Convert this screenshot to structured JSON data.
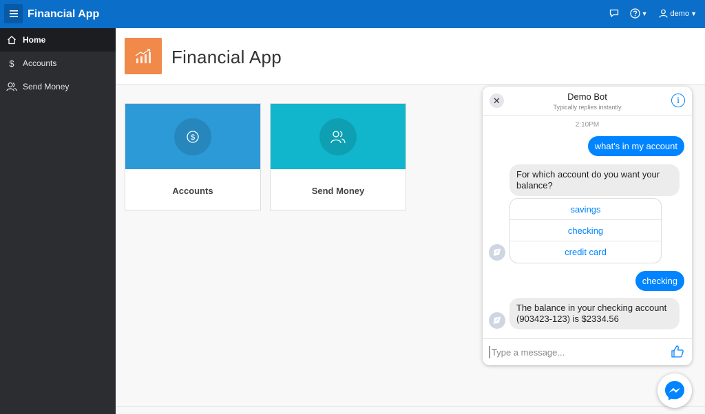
{
  "topbar": {
    "app_title": "Financial App",
    "user_label": "demo",
    "icons": [
      "menu-icon",
      "chat-icon",
      "help-icon",
      "user-icon"
    ]
  },
  "sidebar": {
    "items": [
      {
        "label": "Home",
        "icon": "home-icon",
        "active": true
      },
      {
        "label": "Accounts",
        "icon": "dollar-icon",
        "active": false
      },
      {
        "label": "Send Money",
        "icon": "users-icon",
        "active": false
      }
    ]
  },
  "header": {
    "title": "Financial App",
    "logo_icon": "growth-chart-icon",
    "logo_color": "#f0894a"
  },
  "cards": [
    {
      "label": "Accounts",
      "icon": "dollar-icon",
      "color": "#2d9ad8"
    },
    {
      "label": "Send Money",
      "icon": "users-icon",
      "color": "#12b6cc"
    }
  ],
  "chat": {
    "bot_name": "Demo Bot",
    "subtitle": "Typically replies instantly",
    "time": "2:10PM",
    "messages": [
      {
        "from": "user",
        "text": "what's in my account"
      },
      {
        "from": "bot",
        "text": "For which account do you want your balance?"
      },
      {
        "from": "user",
        "text": "checking"
      },
      {
        "from": "bot",
        "text": "The balance in your checking account (903423-123) is $2334.56"
      }
    ],
    "quick_replies": [
      "savings",
      "checking",
      "credit card"
    ],
    "input_placeholder": "Type a message...",
    "accent_color": "#0084ff"
  },
  "colors": {
    "topbar": "#0b6fca",
    "sidebar": "#2b2d31"
  }
}
